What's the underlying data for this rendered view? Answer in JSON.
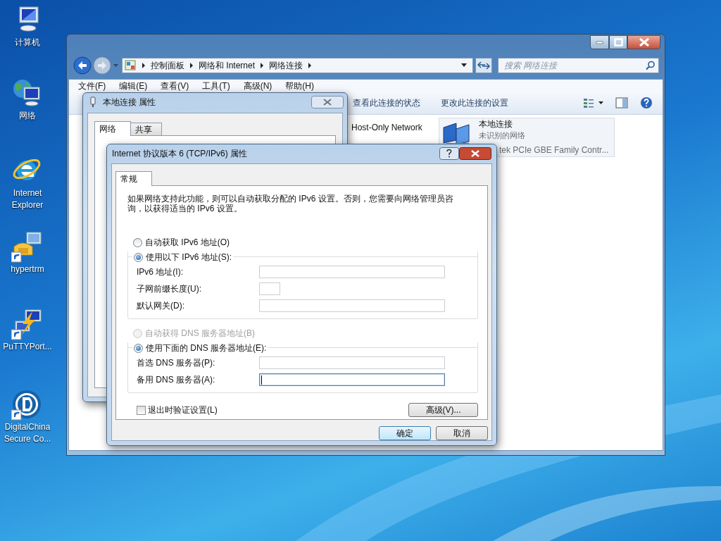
{
  "desktop_icons": [
    {
      "kind": "computer",
      "label": "计算机"
    },
    {
      "kind": "network",
      "label": "网络"
    },
    {
      "kind": "browser",
      "label": "Internet Explorer"
    },
    {
      "kind": "phone",
      "label": "hypertrm",
      "shortcut": true
    },
    {
      "kind": "bolt",
      "label": "PuTTYPort...",
      "shortcut": true
    },
    {
      "kind": "disc",
      "label": "DigitalChina Secure Co...",
      "shortcut": true
    }
  ],
  "explorer": {
    "breadcrumbs": [
      "控制面板",
      "网络和 Internet",
      "网络连接"
    ],
    "search": {
      "placeholder": "搜索 网络连接"
    },
    "menu": [
      "文件(F)",
      "编辑(E)",
      "查看(V)",
      "工具(T)",
      "高级(N)",
      "帮助(H)"
    ],
    "commands": [
      "查看此连接的状态",
      "更改此连接的设置"
    ],
    "connections": [
      {
        "kind": "partial",
        "name": "Host-Only Network"
      },
      {
        "kind": "card",
        "name": "本地连接",
        "status": "未识别的网络",
        "device": "tek PCIe GBE Family Contr..."
      }
    ]
  },
  "lan_dialog": {
    "title": "本地连接 属性",
    "tabs": [
      {
        "label": "网络",
        "selected": true
      },
      {
        "label": "共享",
        "selected": false
      }
    ]
  },
  "ipv6_dialog": {
    "title": "Internet 协议版本 6 (TCP/IPv6) 属性",
    "tabs": [
      {
        "label": "常规",
        "selected": true
      }
    ],
    "description": "如果网络支持此功能，则可以自动获取分配的 IPv6 设置。否则，您需要向网络管理员咨询，以获得适当的 IPv6 设置。",
    "groups": [
      {
        "auto": {
          "label": "自动获取 IPv6 地址(O)",
          "selected": false,
          "disabled": false
        },
        "manual": {
          "label": "使用以下 IPv6 地址(S):",
          "selected": true
        },
        "fields": [
          {
            "label": "IPv6 地址(I):",
            "kind": "wide",
            "focused": false
          },
          {
            "label": "子网前缀长度(U):",
            "kind": "narrow",
            "focused": false
          },
          {
            "label": "默认网关(D):",
            "kind": "wide",
            "focused": false
          }
        ]
      },
      {
        "auto": {
          "label": "自动获得 DNS 服务器地址(B)",
          "selected": false,
          "disabled": true
        },
        "manual": {
          "label": "使用下面的 DNS 服务器地址(E):",
          "selected": true
        },
        "fields": [
          {
            "label": "首选 DNS 服务器(P):",
            "kind": "wide",
            "focused": false
          },
          {
            "label": "备用 DNS 服务器(A):",
            "kind": "wide",
            "focused": true
          }
        ]
      }
    ],
    "validate": {
      "label": "退出时验证设置(L)",
      "checked": false
    },
    "advanced_button": "高级(V)...",
    "buttons": [
      {
        "label": "确定",
        "default": true
      },
      {
        "label": "取消",
        "default": false
      }
    ]
  }
}
